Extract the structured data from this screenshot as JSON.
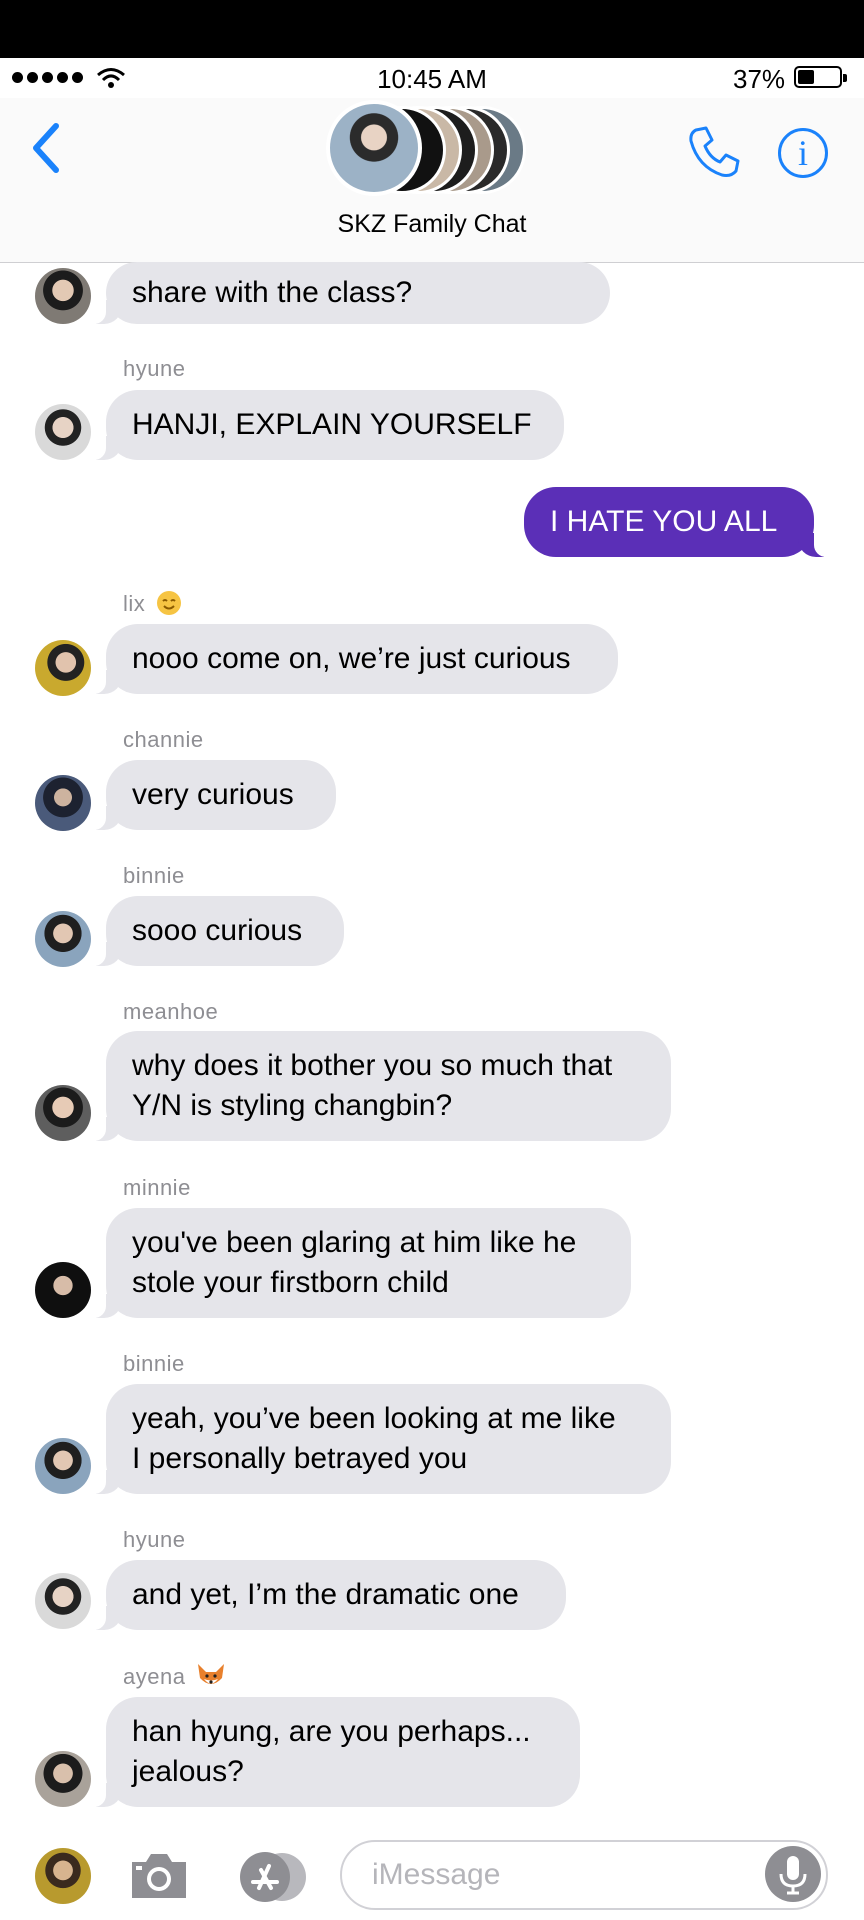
{
  "status_bar": {
    "time": "10:45 AM",
    "battery": "37%"
  },
  "header": {
    "title": "SKZ Family Chat"
  },
  "messages": [
    {
      "sender": "",
      "text": "share with the class?"
    },
    {
      "sender": "hyune",
      "text": "HANJI, EXPLAIN YOURSELF"
    },
    {
      "sender": "",
      "text": "I HATE YOU ALL",
      "outgoing": true
    },
    {
      "sender": "lix",
      "text": "nooo come on, we’re just curious"
    },
    {
      "sender": "channie",
      "text": "very curious"
    },
    {
      "sender": "binnie",
      "text": "sooo curious"
    },
    {
      "sender": "meanhoe",
      "text": "why does it bother you so much that\nY/N is styling changbin?"
    },
    {
      "sender": "minnie",
      "text": "you've been glaring at him like he\nstole your firstborn child"
    },
    {
      "sender": "binnie",
      "text": "yeah, you’ve been looking at me like\nI personally betrayed you"
    },
    {
      "sender": "hyune",
      "text": "and yet, I’m the dramatic one"
    },
    {
      "sender": "ayena",
      "text": "han hyung, are you perhaps...\njealous?"
    }
  ],
  "composer": {
    "placeholder": "iMessage"
  },
  "icons": {
    "back": "chevron-left-icon",
    "phone": "phone-icon",
    "info": "info-icon",
    "camera": "camera-icon",
    "apps": "app-store-icon",
    "mic": "microphone-icon",
    "lix_emoji": "smiling-face-emoji",
    "ayena_emoji": "fox-face-emoji"
  },
  "colors": {
    "accent": "#1a82fb",
    "outgoing_bubble": "#5b2fb7",
    "incoming_bubble": "#e5e5ea"
  }
}
